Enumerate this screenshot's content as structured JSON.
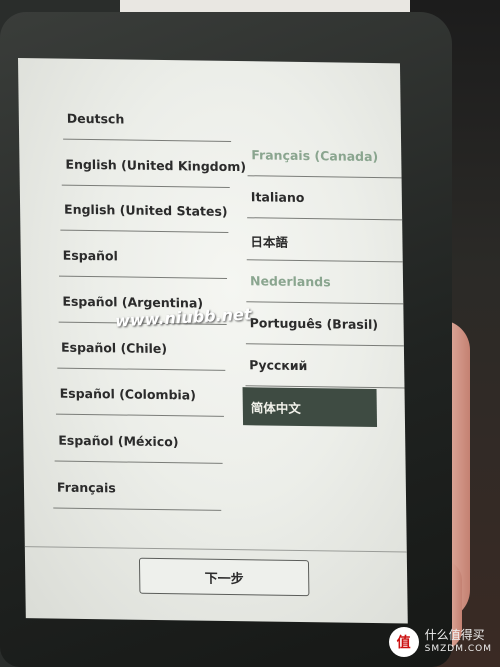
{
  "screen": {
    "left_column": [
      {
        "label": "Deutsch"
      },
      {
        "label": "English (United Kingdom)"
      },
      {
        "label": "English (United States)"
      },
      {
        "label": "Español"
      },
      {
        "label": "Español (Argentina)"
      },
      {
        "label": "Español (Chile)"
      },
      {
        "label": "Español (Colombia)"
      },
      {
        "label": "Español (México)"
      },
      {
        "label": "Français"
      }
    ],
    "right_column": [
      {
        "label": "Français (Canada)"
      },
      {
        "label": "Italiano"
      },
      {
        "label": "日本語"
      },
      {
        "label": "Nederlands"
      },
      {
        "label": "Português (Brasil)"
      },
      {
        "label": "Русский"
      },
      {
        "label": "简体中文",
        "selected": true
      }
    ],
    "next_button_label": "下一步"
  },
  "overlay": {
    "watermark": "www.niubb.net",
    "brand_name": "什么值得买",
    "brand_domain": "SMZDM.COM",
    "brand_logo": "值"
  }
}
